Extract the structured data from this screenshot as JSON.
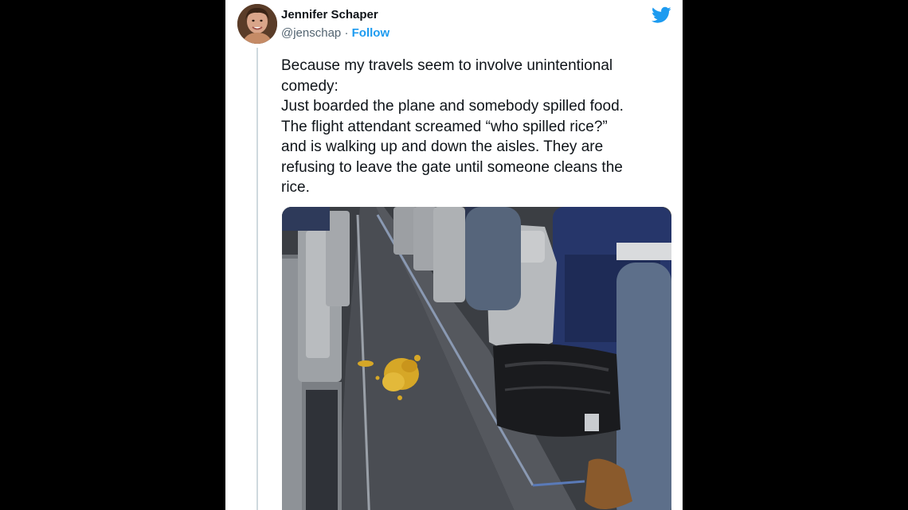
{
  "tweet": {
    "author_name": "Jennifer Schaper",
    "handle": "@jenschap",
    "separator": " · ",
    "follow_label": "Follow",
    "text": "Because my travels seem to involve unintentional\ncomedy:\nJust boarded the plane and somebody spilled food.\nThe flight attendant screamed “who spilled rice?”\nand is walking up and down the aisles. They are\nrefusing to leave the gate until someone cleans the\nrice.",
    "brand_icon": "twitter-bird-icon",
    "brand_color": "#1d9bf0"
  }
}
